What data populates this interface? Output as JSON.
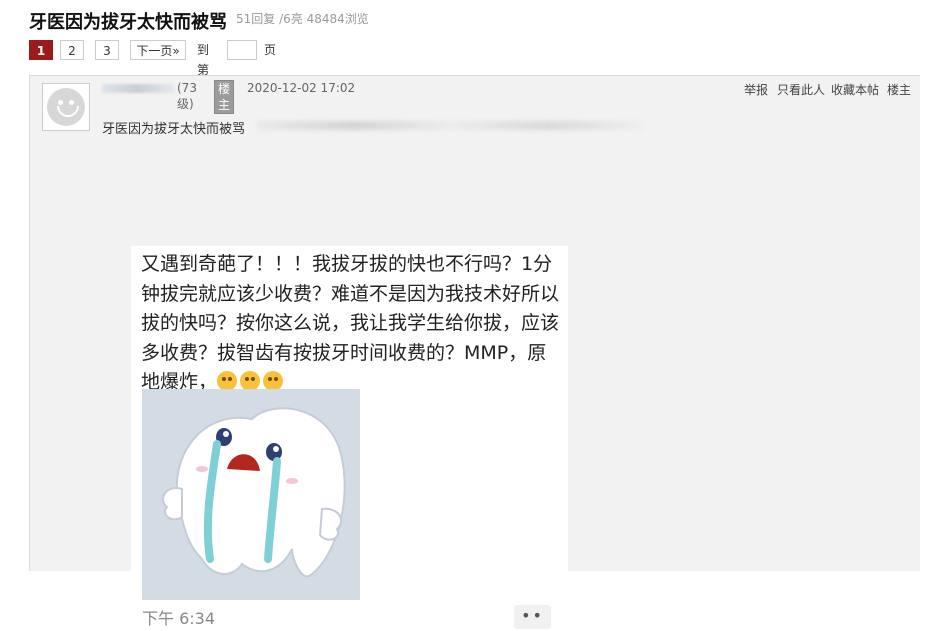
{
  "header": {
    "title": "牙医因为拔牙太快而被骂",
    "stats": "51回复 /6亮   48484浏览"
  },
  "pager": {
    "pages": [
      "1",
      "2",
      "3"
    ],
    "next": "下一页»",
    "goto_prefix": "到第",
    "goto_suffix": "页",
    "current": "1"
  },
  "post": {
    "level": "(73级)",
    "badge": "楼主",
    "time": "2020-12-02 17:02",
    "actions": [
      "举报",
      "只看此人",
      "收藏本帖",
      "楼主"
    ],
    "first_line": "牙医因为拔牙太快而被骂",
    "message": {
      "text": "又遇到奇葩了！！！我拔牙拔的快也不行吗？1分钟拔完就应该少收费？难道不是因为我技术好所以拔的快吗？按你这么说，我让我学生给你拔，应该多收费？拔智齿有按拔牙时间收费的？MMP，原地爆炸，",
      "time": "下午 6:34",
      "more": "••"
    }
  },
  "colors": {
    "accent": "#9b1b1b",
    "post_bg": "#f2f2f2"
  },
  "icons": [
    "avatar-placeholder-icon",
    "crying-tooth-sticker",
    "grimace-emoji-icon"
  ]
}
